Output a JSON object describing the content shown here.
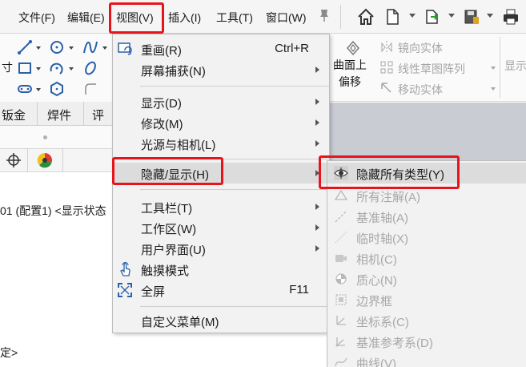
{
  "menubar": {
    "items": [
      {
        "label": "文件(F)"
      },
      {
        "label": "编辑(E)"
      },
      {
        "label": "视图(V)"
      },
      {
        "label": "插入(I)"
      },
      {
        "label": "工具(T)"
      },
      {
        "label": "窗口(W)"
      }
    ],
    "toolbar_icons": [
      "home-icon",
      "new-document-icon",
      "open-icon",
      "save-icon",
      "print-icon"
    ]
  },
  "left_toolbar": {
    "side_char": "寸",
    "icons": [
      "line-icon",
      "circle-icon",
      "spline-icon",
      "rectangle-icon",
      "arc-icon",
      "ellipse-icon",
      "slot-icon",
      "polygon-icon",
      "fillet-icon"
    ]
  },
  "right_panel": {
    "offset_surface": "曲面上",
    "offset_surface_2": "偏移",
    "mirror_entities": "镜向实体",
    "linear_pattern": "线性草图阵列",
    "move_entities": "移动实体",
    "display": "显示"
  },
  "tabs": [
    {
      "label": "钣金"
    },
    {
      "label": "焊件"
    },
    {
      "label": "评"
    }
  ],
  "tree": {
    "config_line": "01 (配置1) <显示状态",
    "bottom_line": "定>"
  },
  "view_menu": {
    "items": [
      {
        "label": "重画(R)",
        "shortcut": "Ctrl+R"
      },
      {
        "label": "屏幕捕获(N)"
      },
      {
        "label": "显示(D)"
      },
      {
        "label": "修改(M)"
      },
      {
        "label": "光源与相机(L)"
      },
      {
        "label": "隐藏/显示(H)"
      },
      {
        "label": "工具栏(T)"
      },
      {
        "label": "工作区(W)"
      },
      {
        "label": "用户界面(U)"
      },
      {
        "label": "触摸模式"
      },
      {
        "label": "全屏",
        "shortcut": "F11"
      },
      {
        "label": "自定义菜单(M)"
      }
    ]
  },
  "hide_show_submenu": {
    "items": [
      {
        "label": "隐藏所有类型(Y)"
      },
      {
        "label": "所有注解(A)"
      },
      {
        "label": "基准轴(A)"
      },
      {
        "label": "临时轴(X)"
      },
      {
        "label": "相机(C)"
      },
      {
        "label": "质心(N)"
      },
      {
        "label": "边界框"
      },
      {
        "label": "坐标系(C)"
      },
      {
        "label": "基准参考系(D)"
      },
      {
        "label": "曲线(V)"
      }
    ]
  },
  "colors": {
    "highlight_border": "#e8141b",
    "menu_bg": "#f2f2f2",
    "hover_bg": "#dcdcdc"
  }
}
